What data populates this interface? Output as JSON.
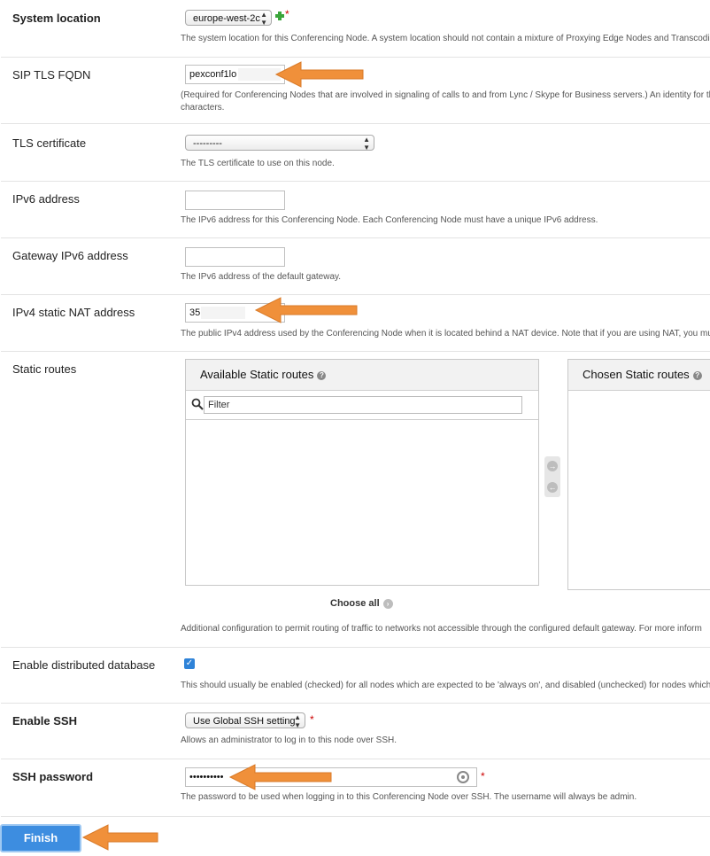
{
  "rows": {
    "system_location": {
      "label": "System location",
      "value": "europe-west-2c",
      "help": "The system location for this Conferencing Node. A system location should not contain a mixture of Proxying Edge Nodes and Transcodi"
    },
    "sip_tls_fqdn": {
      "label": "SIP TLS FQDN",
      "value": "pexconf1lo",
      "help_line1": "(Required for Conferencing Nodes that are involved in signaling of calls to and from Lync / Skype for Business servers.) An identity for th",
      "help_line2": "characters."
    },
    "tls_certificate": {
      "label": "TLS certificate",
      "value": "---------",
      "help": "The TLS certificate to use on this node."
    },
    "ipv6_address": {
      "label": "IPv6 address",
      "value": "",
      "help": "The IPv6 address for this Conferencing Node. Each Conferencing Node must have a unique IPv6 address."
    },
    "gateway_ipv6": {
      "label": "Gateway IPv6 address",
      "value": "",
      "help": "The IPv6 address of the default gateway."
    },
    "ipv4_nat": {
      "label": "IPv4 static NAT address",
      "value": "35.",
      "help": "The public IPv4 address used by the Conferencing Node when it is located behind a NAT device. Note that if you are using NAT, you mus"
    },
    "static_routes": {
      "label": "Static routes",
      "available_title": "Available Static routes",
      "chosen_title": "Chosen Static routes",
      "filter_placeholder": "Filter",
      "choose_all": "Choose all",
      "help": "Additional configuration to permit routing of traffic to networks not accessible through the configured default gateway. For more inform"
    },
    "distributed_db": {
      "label": "Enable distributed database",
      "checked": true,
      "help": "This should usually be enabled (checked) for all nodes which are expected to be 'always on', and disabled (unchecked) for nodes which a"
    },
    "enable_ssh": {
      "label": "Enable SSH",
      "value": "Use Global SSH setting",
      "help": "Allows an administrator to log in to this node over SSH."
    },
    "ssh_password": {
      "label": "SSH password",
      "value": "••••••••••",
      "help": "The password to be used when logging in to this Conferencing Node over SSH. The username will always be admin."
    }
  },
  "finish_label": "Finish",
  "required_mark": "*",
  "colors": {
    "accent": "#3d8de0",
    "arrow": "#f0903a",
    "required": "#cc0000"
  }
}
